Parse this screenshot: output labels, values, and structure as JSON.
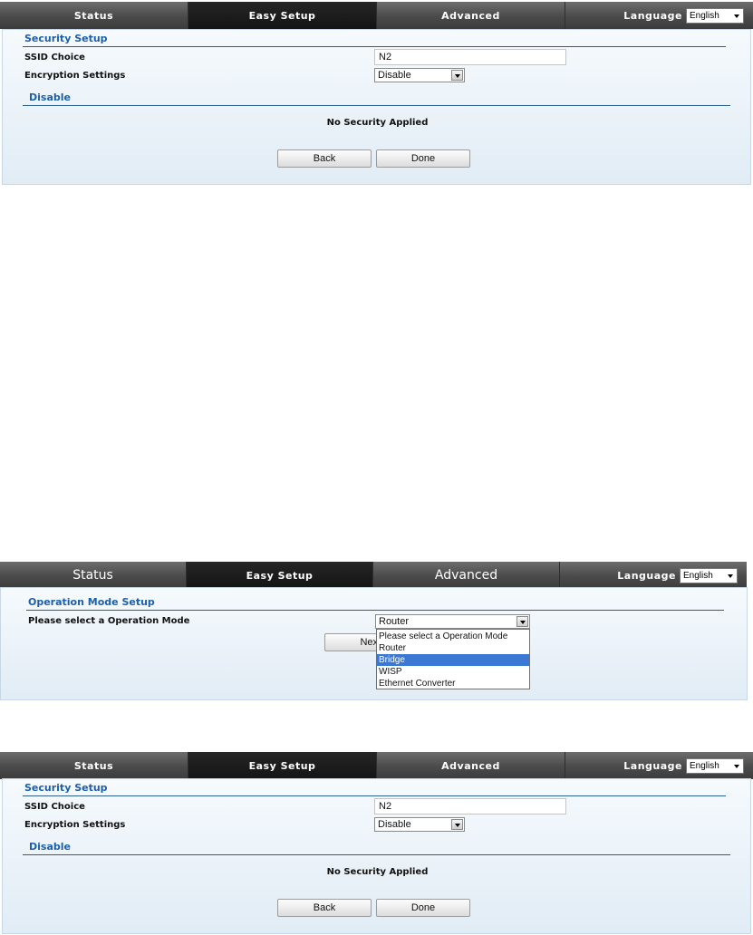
{
  "screens": [
    {
      "nav": {
        "tabs": [
          "Status",
          "Easy Setup",
          "Advanced"
        ],
        "language_label": "Language",
        "language_value": "English"
      },
      "section_title": "Security Setup",
      "ssid_label": "SSID Choice",
      "ssid_value": "N2",
      "encryption_label": "Encryption Settings",
      "encryption_value": "Disable",
      "subsection_title": "Disable",
      "message": "No Security Applied",
      "back_label": "Back",
      "done_label": "Done"
    },
    {
      "nav": {
        "tabs": [
          "Status",
          "Easy Setup",
          "Advanced"
        ],
        "language_label": "Language",
        "language_value": "English"
      },
      "section_title": "Operation Mode Setup",
      "mode_label": "Please select a Operation Mode",
      "mode_value": "Router",
      "next_label": "Nex",
      "options": [
        "Please select a Operation Mode",
        "Router",
        "Bridge",
        "WISP",
        "Ethernet Converter"
      ],
      "highlighted_option": "Bridge"
    },
    {
      "nav": {
        "tabs": [
          "Status",
          "Easy Setup",
          "Advanced"
        ],
        "language_label": "Language",
        "language_value": "English"
      },
      "section_title": "Security Setup",
      "ssid_label": "SSID Choice",
      "ssid_value": "N2",
      "encryption_label": "Encryption Settings",
      "encryption_value": "Disable",
      "subsection_title": "Disable",
      "message": "No Security Applied",
      "back_label": "Back",
      "done_label": "Done"
    }
  ],
  "colors": {
    "nav_dark": "#4a4a4a",
    "nav_active": "#1a1a1a",
    "heading_blue": "#1d5fa8",
    "panel_bg": "#e8f0f7",
    "highlight": "#3a78d4"
  }
}
